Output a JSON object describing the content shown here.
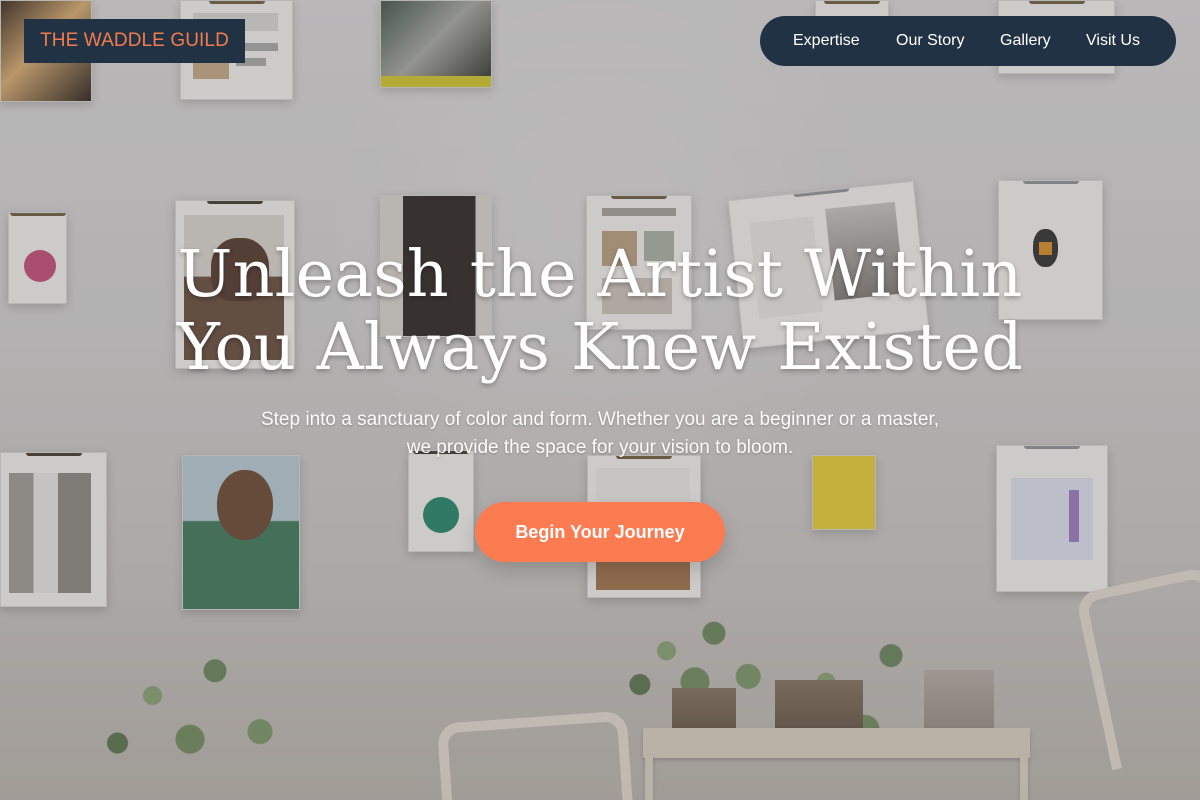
{
  "header": {
    "brand": "THE WADDLE GUILD",
    "nav": [
      {
        "label": "Expertise"
      },
      {
        "label": "Our Story"
      },
      {
        "label": "Gallery"
      },
      {
        "label": "Visit Us"
      }
    ]
  },
  "hero": {
    "title_lines": [
      "Unleash the Artist Within",
      "You Always Knew Existed"
    ],
    "subtitle": "Step into a sanctuary of color and form. Whether you are a beginner or a master, we provide the space for your vision to bloom.",
    "cta_label": "Begin Your Journey"
  },
  "colors": {
    "brand_orange": "#fc7b51",
    "navy": "#223245",
    "white": "#ffffff"
  },
  "icons": [
    "clipboard-icon",
    "plant-icon",
    "chair-icon"
  ]
}
